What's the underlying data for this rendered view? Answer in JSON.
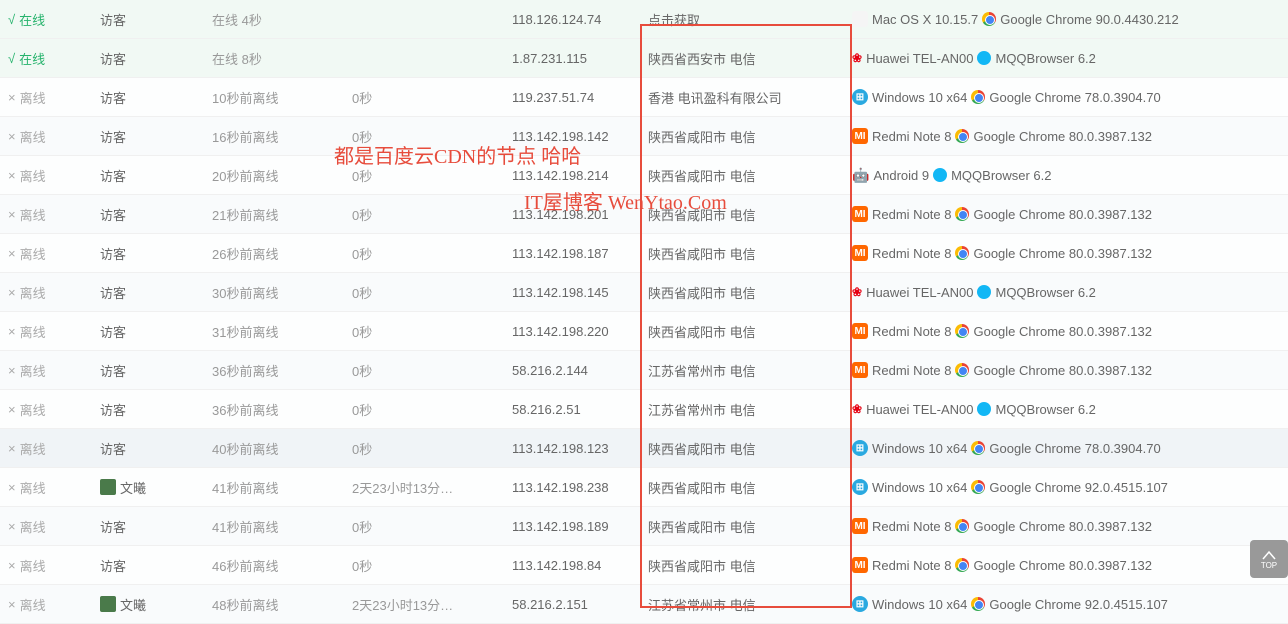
{
  "annotations": {
    "line1": "都是百度云CDN的节点 哈哈",
    "line2": "IT屋博客 WenYtao.Com"
  },
  "scrolltop_label": "TOP",
  "rows": [
    {
      "status": "在线",
      "status_mark": "√",
      "status_kind": "online",
      "visitor": "访客",
      "visitor_avatar": false,
      "time": "在线 4秒",
      "duration": "",
      "ip": "118.126.124.74",
      "location": "点击获取",
      "os_icon": "apple",
      "os": "Mac OS X 10.15.7",
      "br_icon": "chrome",
      "browser": "Google Chrome 90.0.4430.212"
    },
    {
      "status": "在线",
      "status_mark": "√",
      "status_kind": "online",
      "visitor": "访客",
      "visitor_avatar": false,
      "time": "在线 8秒",
      "duration": "",
      "ip": "1.87.231.115",
      "location": "陕西省西安市 电信",
      "os_icon": "huawei",
      "os": "Huawei TEL-AN00",
      "br_icon": "qq",
      "browser": "MQQBrowser 6.2"
    },
    {
      "status": "离线",
      "status_mark": "×",
      "status_kind": "offline",
      "visitor": "访客",
      "visitor_avatar": false,
      "time": "10秒前离线",
      "duration": "0秒",
      "ip": "119.237.51.74",
      "location": "香港 电讯盈科有限公司",
      "os_icon": "win",
      "os": "Windows 10 x64",
      "br_icon": "chrome",
      "browser": "Google Chrome 78.0.3904.70"
    },
    {
      "status": "离线",
      "status_mark": "×",
      "status_kind": "offline",
      "visitor": "访客",
      "visitor_avatar": false,
      "time": "16秒前离线",
      "duration": "0秒",
      "ip": "113.142.198.142",
      "location": "陕西省咸阳市 电信",
      "os_icon": "mi",
      "os": "Redmi Note 8",
      "br_icon": "chrome",
      "browser": "Google Chrome 80.0.3987.132"
    },
    {
      "status": "离线",
      "status_mark": "×",
      "status_kind": "offline",
      "visitor": "访客",
      "visitor_avatar": false,
      "time": "20秒前离线",
      "duration": "0秒",
      "ip": "113.142.198.214",
      "location": "陕西省咸阳市 电信",
      "os_icon": "android",
      "os": "Android 9",
      "br_icon": "qq",
      "browser": "MQQBrowser 6.2"
    },
    {
      "status": "离线",
      "status_mark": "×",
      "status_kind": "offline",
      "visitor": "访客",
      "visitor_avatar": false,
      "time": "21秒前离线",
      "duration": "0秒",
      "ip": "113.142.198.201",
      "location": "陕西省咸阳市 电信",
      "os_icon": "mi",
      "os": "Redmi Note 8",
      "br_icon": "chrome",
      "browser": "Google Chrome 80.0.3987.132"
    },
    {
      "status": "离线",
      "status_mark": "×",
      "status_kind": "offline",
      "visitor": "访客",
      "visitor_avatar": false,
      "time": "26秒前离线",
      "duration": "0秒",
      "ip": "113.142.198.187",
      "location": "陕西省咸阳市 电信",
      "os_icon": "mi",
      "os": "Redmi Note 8",
      "br_icon": "chrome",
      "browser": "Google Chrome 80.0.3987.132"
    },
    {
      "status": "离线",
      "status_mark": "×",
      "status_kind": "offline",
      "visitor": "访客",
      "visitor_avatar": false,
      "time": "30秒前离线",
      "duration": "0秒",
      "ip": "113.142.198.145",
      "location": "陕西省咸阳市 电信",
      "os_icon": "huawei",
      "os": "Huawei TEL-AN00",
      "br_icon": "qq",
      "browser": "MQQBrowser 6.2"
    },
    {
      "status": "离线",
      "status_mark": "×",
      "status_kind": "offline",
      "visitor": "访客",
      "visitor_avatar": false,
      "time": "31秒前离线",
      "duration": "0秒",
      "ip": "113.142.198.220",
      "location": "陕西省咸阳市 电信",
      "os_icon": "mi",
      "os": "Redmi Note 8",
      "br_icon": "chrome",
      "browser": "Google Chrome 80.0.3987.132"
    },
    {
      "status": "离线",
      "status_mark": "×",
      "status_kind": "offline",
      "visitor": "访客",
      "visitor_avatar": false,
      "time": "36秒前离线",
      "duration": "0秒",
      "ip": "58.216.2.144",
      "location": "江苏省常州市 电信",
      "os_icon": "mi",
      "os": "Redmi Note 8",
      "br_icon": "chrome",
      "browser": "Google Chrome 80.0.3987.132"
    },
    {
      "status": "离线",
      "status_mark": "×",
      "status_kind": "offline",
      "visitor": "访客",
      "visitor_avatar": false,
      "time": "36秒前离线",
      "duration": "0秒",
      "ip": "58.216.2.51",
      "location": "江苏省常州市 电信",
      "os_icon": "huawei",
      "os": "Huawei TEL-AN00",
      "br_icon": "qq",
      "browser": "MQQBrowser 6.2"
    },
    {
      "status": "离线",
      "status_mark": "×",
      "status_kind": "offline",
      "visitor": "访客",
      "visitor_avatar": false,
      "time": "40秒前离线",
      "duration": "0秒",
      "ip": "113.142.198.123",
      "location": "陕西省咸阳市 电信",
      "os_icon": "win",
      "os": "Windows 10 x64",
      "br_icon": "chrome",
      "browser": "Google Chrome 78.0.3904.70",
      "highlight": true
    },
    {
      "status": "离线",
      "status_mark": "×",
      "status_kind": "offline",
      "visitor": "文曦",
      "visitor_avatar": true,
      "time": "41秒前离线",
      "duration": "2天23小时13分…",
      "ip": "113.142.198.238",
      "location": "陕西省咸阳市 电信",
      "os_icon": "win",
      "os": "Windows 10 x64",
      "br_icon": "chrome",
      "browser": "Google Chrome 92.0.4515.107"
    },
    {
      "status": "离线",
      "status_mark": "×",
      "status_kind": "offline",
      "visitor": "访客",
      "visitor_avatar": false,
      "time": "41秒前离线",
      "duration": "0秒",
      "ip": "113.142.198.189",
      "location": "陕西省咸阳市 电信",
      "os_icon": "mi",
      "os": "Redmi Note 8",
      "br_icon": "chrome",
      "browser": "Google Chrome 80.0.3987.132"
    },
    {
      "status": "离线",
      "status_mark": "×",
      "status_kind": "offline",
      "visitor": "访客",
      "visitor_avatar": false,
      "time": "46秒前离线",
      "duration": "0秒",
      "ip": "113.142.198.84",
      "location": "陕西省咸阳市 电信",
      "os_icon": "mi",
      "os": "Redmi Note 8",
      "br_icon": "chrome",
      "browser": "Google Chrome 80.0.3987.132"
    },
    {
      "status": "离线",
      "status_mark": "×",
      "status_kind": "offline",
      "visitor": "文曦",
      "visitor_avatar": true,
      "time": "48秒前离线",
      "duration": "2天23小时13分…",
      "ip": "58.216.2.151",
      "location": "江苏省常州市 电信",
      "os_icon": "win",
      "os": "Windows 10 x64",
      "br_icon": "chrome",
      "browser": "Google Chrome 92.0.4515.107"
    }
  ]
}
